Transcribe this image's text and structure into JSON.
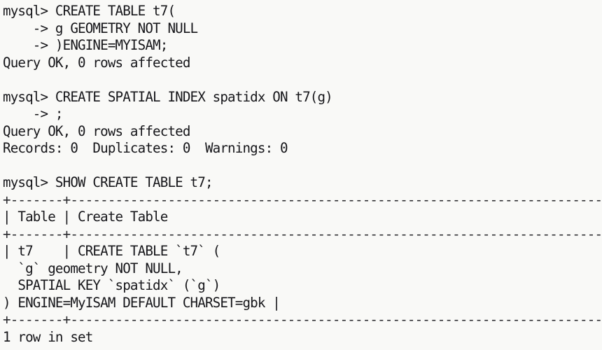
{
  "terminal": {
    "app": "mysql-client-console",
    "prompt": "mysql>",
    "continuation_prompt": "->",
    "colors": {
      "background": "#f9f9f7",
      "foreground": "#16161a",
      "rule": "#2a2a2e"
    },
    "lines": [
      {
        "id": "line-01",
        "kind": "command",
        "text": "mysql> CREATE TABLE t7("
      },
      {
        "id": "line-02",
        "kind": "command",
        "text": "    -> g GEOMETRY NOT NULL"
      },
      {
        "id": "line-03",
        "kind": "command",
        "text": "    -> )ENGINE=MYISAM;"
      },
      {
        "id": "line-04",
        "kind": "result",
        "text": "Query OK, 0 rows affected"
      },
      {
        "id": "line-05",
        "kind": "blank",
        "text": ""
      },
      {
        "id": "line-06",
        "kind": "command",
        "text": "mysql> CREATE SPATIAL INDEX spatidx ON t7(g)"
      },
      {
        "id": "line-07",
        "kind": "command",
        "text": "    -> ;"
      },
      {
        "id": "line-08",
        "kind": "result",
        "text": "Query OK, 0 rows affected"
      },
      {
        "id": "line-09",
        "kind": "result",
        "text": "Records: 0  Duplicates: 0  Warnings: 0"
      },
      {
        "id": "line-10",
        "kind": "blank",
        "text": ""
      },
      {
        "id": "line-11",
        "kind": "command",
        "text": "mysql> SHOW CREATE TABLE t7;"
      },
      {
        "id": "line-12",
        "kind": "rule",
        "text": "+-------+----------------------------------------------------------------------------"
      },
      {
        "id": "line-13",
        "kind": "header",
        "text": "| Table | Create Table"
      },
      {
        "id": "line-14",
        "kind": "rule",
        "text": "+-------+----------------------------------------------------------------------------"
      },
      {
        "id": "line-15",
        "kind": "row",
        "text": "| t7    | CREATE TABLE `t7` ("
      },
      {
        "id": "line-16",
        "kind": "row",
        "text": "  `g` geometry NOT NULL,"
      },
      {
        "id": "line-17",
        "kind": "row",
        "text": "  SPATIAL KEY `spatidx` (`g`)"
      },
      {
        "id": "line-18",
        "kind": "row",
        "text": ") ENGINE=MyISAM DEFAULT CHARSET=gbk |"
      },
      {
        "id": "line-19",
        "kind": "rule",
        "text": "+-------+----------------------------------------------------------------------------"
      },
      {
        "id": "line-20",
        "kind": "result",
        "text": "1 row in set"
      }
    ]
  }
}
